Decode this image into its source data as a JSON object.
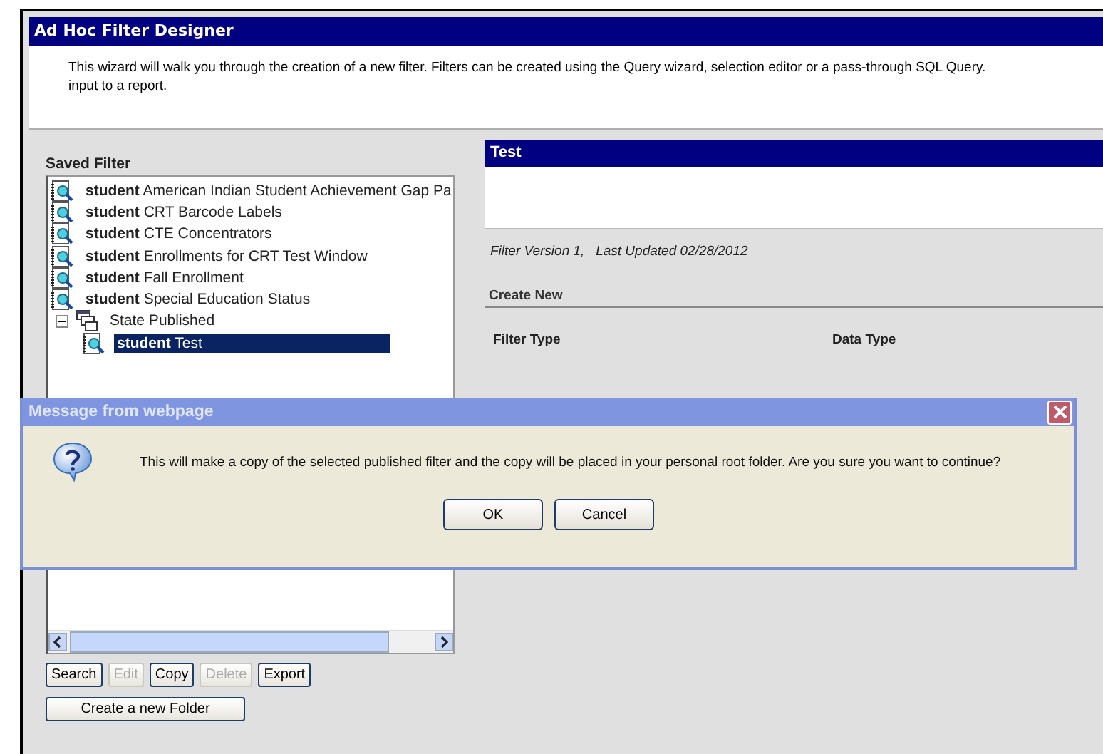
{
  "window": {
    "title": "Ad Hoc Filter Designer"
  },
  "description": [
    "This wizard will walk you through the creation of a new filter. Filters can be created using the Query wizard, selection editor or a pass-through SQL Query.",
    "input to a report."
  ],
  "saved_filter": {
    "label": "Saved Filter",
    "items": [
      {
        "kind": "filter",
        "text": "**student** American Indian Student Achievement Gap Pa",
        "selected": false
      },
      {
        "kind": "filter",
        "text": "**student** CRT Barcode Labels",
        "selected": false
      },
      {
        "kind": "filter",
        "text": "**student** CTE Concentrators",
        "selected": false
      },
      {
        "kind": "filter",
        "text": "**student** Enrollments for CRT Test Window",
        "selected": false
      },
      {
        "kind": "filter",
        "text": "**student** Fall Enrollment",
        "selected": false
      },
      {
        "kind": "filter",
        "text": "**student** Special Education Status",
        "selected": false
      },
      {
        "kind": "folder",
        "text": "State Published",
        "expanded": true,
        "selected": false,
        "children": [
          {
            "kind": "filter",
            "text": "**student** Test",
            "selected": true
          }
        ]
      }
    ],
    "buttons": [
      {
        "label": "Search",
        "disabled": false
      },
      {
        "label": "Edit",
        "disabled": true
      },
      {
        "label": "Copy",
        "disabled": false
      },
      {
        "label": "Delete",
        "disabled": true
      },
      {
        "label": "Export",
        "disabled": false
      }
    ],
    "folder_button": "Create a new Folder"
  },
  "detail": {
    "title": "Test",
    "version": "Filter Version 1,   Last Updated 02/28/2012",
    "section": "Create New",
    "columns": [
      "Filter Type",
      "Data Type"
    ]
  },
  "dialog": {
    "title": "Message from webpage",
    "message": "This will make a copy of the selected published filter and the copy will be placed in your personal root folder. Are you sure you want to continue?",
    "buttons": [
      "OK",
      "Cancel"
    ]
  }
}
